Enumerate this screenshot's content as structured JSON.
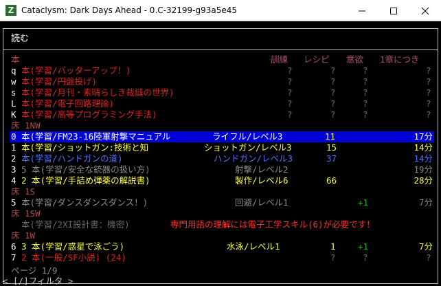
{
  "window": {
    "title": "Cataclysm: Dark Days Ahead - 0.C-32199-g93a5e45",
    "icon_letter": "Z"
  },
  "menu": {
    "title": "読む",
    "headers": {
      "category": "本",
      "training": "訓練",
      "recipes": "レシピ",
      "fun": "意欲",
      "per_chapter": "1章につき"
    }
  },
  "sections": {
    "inventory_rows": [
      {
        "key": "q",
        "name": "本(学習/バッターアップ！)",
        "training": "?",
        "recipes": "?",
        "fun": "?",
        "chapter": "?"
      },
      {
        "key": "w",
        "name": "本(学習/円盤投げ)",
        "training": "?",
        "recipes": "?",
        "fun": "?",
        "chapter": "?"
      },
      {
        "key": "s",
        "name": "本(学習/月刊・素晴らしき裁縫の世界)",
        "training": "?",
        "recipes": "?",
        "fun": "?",
        "chapter": "?"
      },
      {
        "key": "L",
        "name": "本(学習/電子回路理論)",
        "training": "?",
        "recipes": "?",
        "fun": "?",
        "chapter": "?"
      },
      {
        "key": "K",
        "name": "本(学習/高等プログラミング手法)",
        "training": "?",
        "recipes": "?",
        "fun": "?",
        "chapter": "?"
      }
    ],
    "floor_1nw": {
      "label": "床 1NW",
      "rows": [
        {
          "key": "0",
          "name": "本(学習/FM23-16陸軍射撃マニュアル",
          "training": "ライフル/レベル3",
          "recipes": "11",
          "fun": "",
          "chapter": "17分"
        },
        {
          "key": "1",
          "name": "本(学習/ショットガン:技術と知",
          "training": "ショットガン/レベル3",
          "recipes": "15",
          "fun": "",
          "chapter": "14分"
        },
        {
          "key": "2",
          "name": "本(学習/ハンドガンの道)",
          "training": "ハンドガン/レベル3",
          "recipes": "37",
          "fun": "",
          "chapter": "14分"
        },
        {
          "key": "3",
          "name": "5 本(学習/安全な銃器の扱い方)",
          "training": "射撃/レベル2",
          "recipes": "",
          "fun": "",
          "chapter": "19分"
        },
        {
          "key": "4",
          "name": "2 本(学習/手詰め弾薬の解説書)",
          "training": "製作/レベル6",
          "recipes": "66",
          "fun": "",
          "chapter": "28分"
        }
      ]
    },
    "floor_1s": {
      "label": "床 1S",
      "rows": [
        {
          "key": "5",
          "name": "本(学習/ダンスダンスダンス！)",
          "training": "回避/レベル1",
          "recipes": "",
          "fun": "+1",
          "chapter": "7分"
        }
      ]
    },
    "floor_1sw": {
      "label": "床 1SW",
      "rows": [
        {
          "key": "",
          "name": "本(学習/2XI設計書：機密)",
          "warning": "専門用語の理解には電子工学スキル(6)が必要です！"
        }
      ]
    },
    "floor_1w": {
      "label": "床 1W",
      "rows": [
        {
          "key": "6",
          "name": "3 本(学習/惑星で泳ごう)",
          "training": "水泳/レベル1",
          "recipes": "1",
          "fun": "+1",
          "chapter": "7分"
        },
        {
          "key": "7",
          "name": "2 本(一般/SF小説) (24)",
          "training": "",
          "recipes": "?",
          "fun": "?",
          "chapter": "?"
        }
      ]
    }
  },
  "footer": {
    "page": "ページ 1/9",
    "filter": "< [/]フィルタ >"
  },
  "colors": {
    "selection": "#0000d8",
    "unread": "#e02020",
    "readable": "#ffff40",
    "known": "#5070ff"
  }
}
